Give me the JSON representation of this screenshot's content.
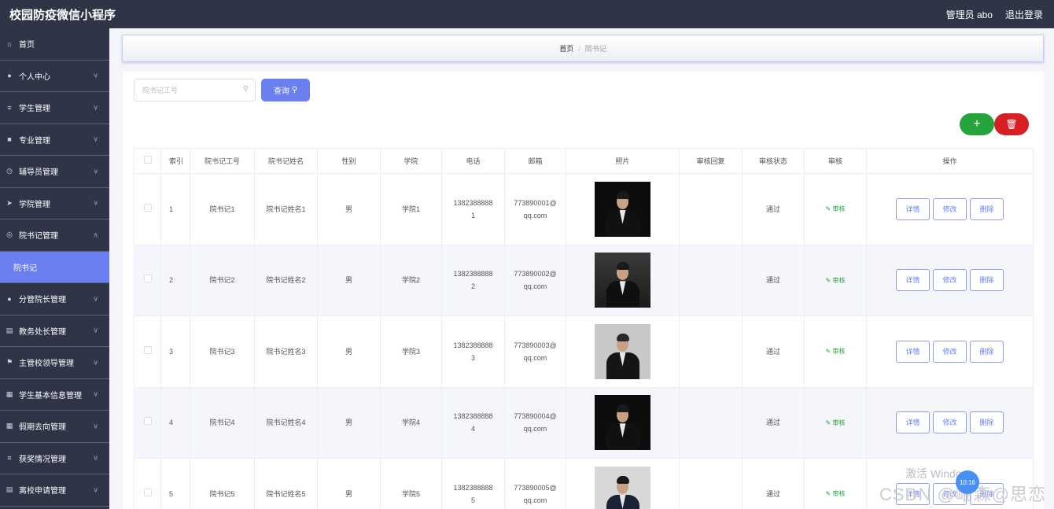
{
  "app": {
    "title": "校园防疫微信小程序"
  },
  "header": {
    "user_label": "管理员 abo",
    "logout_label": "退出登录"
  },
  "sidebar": {
    "items": [
      {
        "label": "首页",
        "icon": "home-icon",
        "expandable": false
      },
      {
        "label": "个人中心",
        "icon": "user-icon",
        "expandable": true
      },
      {
        "label": "学生管理",
        "icon": "list-icon",
        "expandable": true
      },
      {
        "label": "专业管理",
        "icon": "thumb-icon",
        "expandable": true
      },
      {
        "label": "辅导员管理",
        "icon": "clock-icon",
        "expandable": true
      },
      {
        "label": "学院管理",
        "icon": "send-icon",
        "expandable": true
      },
      {
        "label": "院书记管理",
        "icon": "compass-icon",
        "expandable": true,
        "expanded": true
      },
      {
        "label": "院书记",
        "icon": "",
        "sub": true,
        "active": true
      },
      {
        "label": "分管院长管理",
        "icon": "bulb-icon",
        "expandable": true
      },
      {
        "label": "教务处长管理",
        "icon": "clipboard-icon",
        "expandable": true
      },
      {
        "label": "主管校领导管理",
        "icon": "flag-icon",
        "expandable": true
      },
      {
        "label": "学生基本信息管理",
        "icon": "grid-icon",
        "expandable": true
      },
      {
        "label": "假期去向管理",
        "icon": "calendar-icon",
        "expandable": true
      },
      {
        "label": "获奖情况管理",
        "icon": "list-icon",
        "expandable": true
      },
      {
        "label": "离校申请管理",
        "icon": "doc-icon",
        "expandable": true
      }
    ]
  },
  "breadcrumb": {
    "home": "首页",
    "separator": "/",
    "current": "院书记"
  },
  "search": {
    "placeholder": "院书记工号",
    "value": "",
    "button_label": "查询"
  },
  "table": {
    "headers": [
      "索引",
      "院书记工号",
      "院书记姓名",
      "性别",
      "学院",
      "电话",
      "邮箱",
      "照片",
      "审核回复",
      "审核状态",
      "审核",
      "操作"
    ],
    "audit_label": "审核",
    "actions": {
      "detail": "详情",
      "edit": "修改",
      "delete": "删除"
    },
    "rows": [
      {
        "index": "1",
        "id": "院书记1",
        "name": "院书记姓名1",
        "gender": "男",
        "college": "学院1",
        "phone_a": "1382388888",
        "phone_b": "1",
        "email_a": "773890001@",
        "email_b": "qq.com",
        "reply": "",
        "status": "通过",
        "photo": "male-dark"
      },
      {
        "index": "2",
        "id": "院书记2",
        "name": "院书记姓名2",
        "gender": "男",
        "college": "学院2",
        "phone_a": "1382388888",
        "phone_b": "2",
        "email_a": "773890002@",
        "email_b": "qq.com",
        "reply": "",
        "status": "通过",
        "photo": "male-grey"
      },
      {
        "index": "3",
        "id": "院书记3",
        "name": "院书记姓名3",
        "gender": "男",
        "college": "学院3",
        "phone_a": "1382388888",
        "phone_b": "3",
        "email_a": "773890003@",
        "email_b": "qq.com",
        "reply": "",
        "status": "通过",
        "photo": "female-light"
      },
      {
        "index": "4",
        "id": "院书记4",
        "name": "院书记姓名4",
        "gender": "男",
        "college": "学院4",
        "phone_a": "1382388888",
        "phone_b": "4",
        "email_a": "773890004@",
        "email_b": "qq.com",
        "reply": "",
        "status": "通过",
        "photo": "male-dark"
      },
      {
        "index": "5",
        "id": "院书记5",
        "name": "院书记姓名5",
        "gender": "男",
        "college": "学院5",
        "phone_a": "1382388888",
        "phone_b": "5",
        "email_a": "773890005@",
        "email_b": "qq.com",
        "reply": "",
        "status": "通过",
        "photo": "male-light"
      }
    ]
  },
  "overlay": {
    "watermark_activate": "激活 Windo",
    "watermark_csdn": "CSDN @岫森@思恋",
    "float_badge": "10:16"
  },
  "colors": {
    "header_bg": "#2f3447",
    "accent": "#6b7ff0",
    "add": "#24a43b",
    "delete": "#d82024"
  }
}
